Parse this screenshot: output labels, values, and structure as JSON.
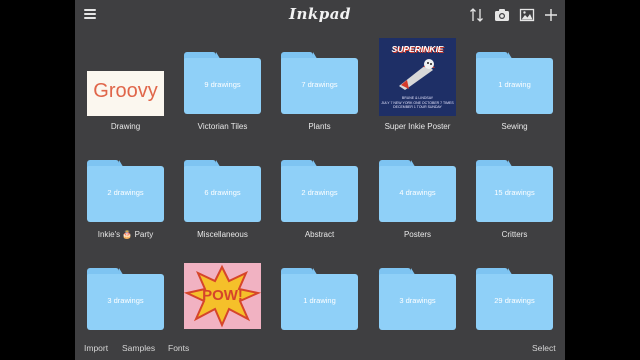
{
  "app": {
    "title": "Inkpad"
  },
  "toolbar": {
    "menu_icon": "hamburger-menu-icon",
    "sort_icon": "sort-arrows-icon",
    "camera_icon": "camera-icon",
    "image_icon": "image-icon",
    "add_icon": "plus-icon"
  },
  "items": [
    {
      "type": "drawing",
      "label": "Drawing",
      "thumb_text": "Groovy"
    },
    {
      "type": "folder",
      "label": "Victorian Tiles",
      "count": "9 drawings"
    },
    {
      "type": "folder",
      "label": "Plants",
      "count": "7 drawings"
    },
    {
      "type": "drawing",
      "label": "Super Inkie Poster",
      "thumb_text": "SUPERINKIE",
      "thumb_caption_lines": [
        "BRUNE & LINDSAY",
        "JULY 7 NEW YORK  ONE  OCTOBER 7 TIMES",
        "DECEMBER 1 TOUR  SUNDAY"
      ]
    },
    {
      "type": "folder",
      "label": "Sewing",
      "count": "1 drawing"
    },
    {
      "type": "folder",
      "label": "Inkie's 🎂 Party",
      "count": "2 drawings"
    },
    {
      "type": "folder",
      "label": "Miscellaneous",
      "count": "6 drawings"
    },
    {
      "type": "folder",
      "label": "Abstract",
      "count": "2 drawings"
    },
    {
      "type": "folder",
      "label": "Posters",
      "count": "4 drawings"
    },
    {
      "type": "folder",
      "label": "Critters",
      "count": "15 drawings"
    },
    {
      "type": "folder",
      "label": "",
      "count": "3 drawings"
    },
    {
      "type": "drawing",
      "label": "",
      "thumb_text": "POW!"
    },
    {
      "type": "folder",
      "label": "",
      "count": "1 drawing"
    },
    {
      "type": "folder",
      "label": "",
      "count": "3 drawings"
    },
    {
      "type": "folder",
      "label": "",
      "count": "29 drawings"
    }
  ],
  "bottombar": {
    "import": "Import",
    "samples": "Samples",
    "fonts": "Fonts",
    "select": "Select"
  },
  "colors": {
    "background": "#3f3f41",
    "folder": "#8fd0f8",
    "folder_tab": "#7ec4f2",
    "groovy_text": "#e0664a"
  }
}
